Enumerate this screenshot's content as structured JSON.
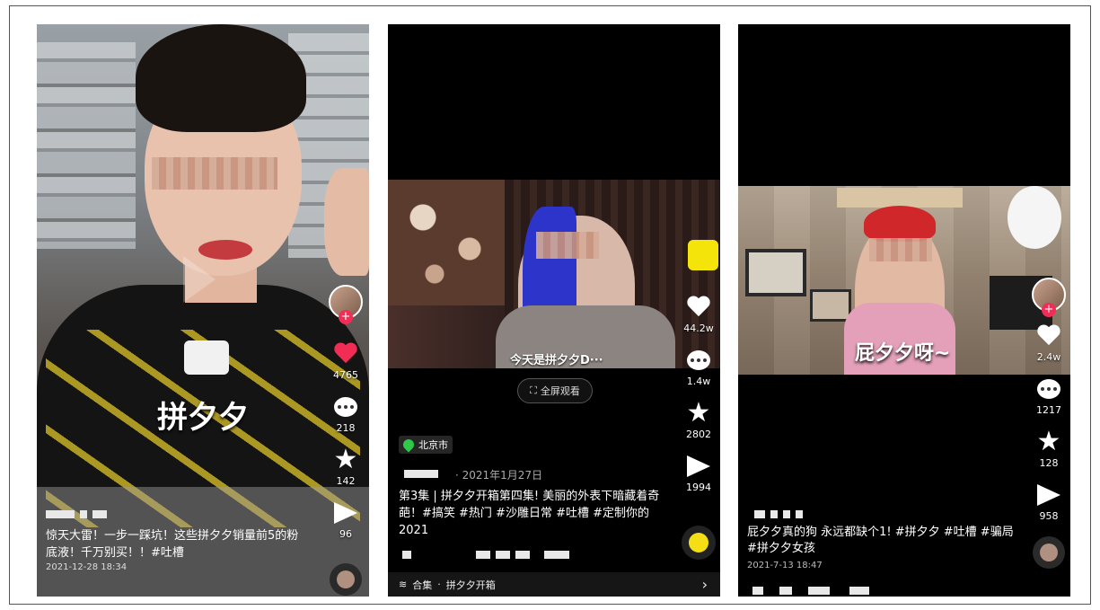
{
  "panels": [
    {
      "subtitle_overlay": "拼夕夕",
      "likes": "4765",
      "comments": "218",
      "favorites": "142",
      "shares": "96",
      "caption": "惊天大雷！一步一踩坑！这些拼夕夕销量前5的粉底液！千万别买！！#吐槽",
      "date": "2021-12-28 18:34"
    },
    {
      "subtitle_overlay": "今天是拼夕夕D···",
      "fullscreen_label": "全屏观看",
      "location": "北京市",
      "date": "· 2021年1月27日",
      "caption": "第3集 | 拼夕夕开箱第四集! 美丽的外表下暗藏着奇葩！#搞笑 #热门 #沙雕日常 #吐槽 #定制你的2021",
      "likes": "44.2w",
      "comments": "1.4w",
      "favorites": "2802",
      "shares": "1994",
      "collection_prefix": "合集",
      "collection_name": "拼夕夕开箱",
      "collection_chevron": "›"
    },
    {
      "subtitle_overlay": "屁夕夕呀~",
      "likes": "2.4w",
      "comments": "1217",
      "favorites": "128",
      "shares": "958",
      "caption": "屁夕夕真的狗 永远都缺个1! #拼夕夕 #吐槽 #骗局 #拼夕夕女孩",
      "date": "2021-7-13 18:47"
    }
  ],
  "colors": {
    "like_red": "#f22d55",
    "background": "#000000",
    "location_pin": "#2fc94a"
  }
}
